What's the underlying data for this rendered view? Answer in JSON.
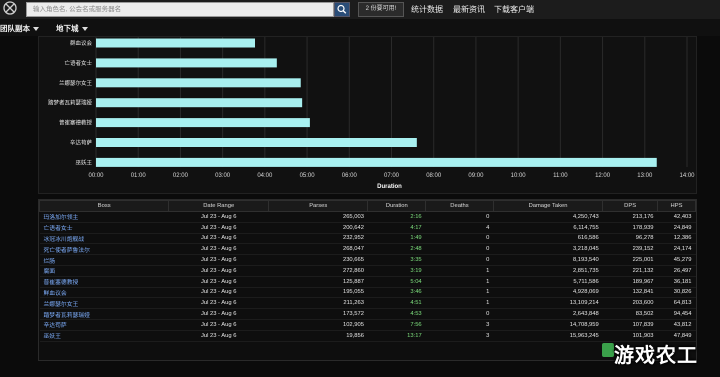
{
  "header": {
    "search_placeholder": "输入角色名, 公会名或服务器名",
    "compare_label": "2 份要可用!",
    "nav": [
      "统计数据",
      "最新资讯",
      "下载客户端"
    ]
  },
  "subnav": {
    "items": [
      "团队副本",
      "地下城"
    ]
  },
  "chart_data": {
    "type": "bar",
    "orientation": "horizontal",
    "categories": [
      "群血议会",
      "亡语者女士",
      "兰娜瑟尔女王",
      "踏梦者瓦莉瑟瑞娅",
      "普崔塞德教授",
      "辛达苟萨",
      "巫妖王"
    ],
    "values_seconds": [
      226,
      257,
      291,
      293,
      304,
      456,
      797
    ],
    "xlabel": "Duration",
    "xlim_seconds": [
      0,
      840
    ],
    "ticks": [
      "00:00",
      "01:00",
      "02:00",
      "03:00",
      "04:00",
      "05:00",
      "06:00",
      "07:00",
      "08:00",
      "09:00",
      "10:00",
      "11:00",
      "12:00",
      "13:00",
      "14:00"
    ],
    "bar_color": "#a8f0f0",
    "grid": true
  },
  "table": {
    "headers": [
      "Boss",
      "Date Range",
      "Parses",
      "Duration",
      "Deaths",
      "Damage Taken",
      "DPS",
      "HPS"
    ],
    "rows": [
      [
        "玛洛加尔领主",
        "Jul 23 - Aug 6",
        "265,003",
        "2:16",
        "0",
        "4,250,743",
        "213,176",
        "42,403"
      ],
      [
        "亡语者女士",
        "Jul 23 - Aug 6",
        "200,642",
        "4:17",
        "4",
        "6,114,755",
        "178,939",
        "24,849"
      ],
      [
        "冰冠冰川炮舰战",
        "Jul 23 - Aug 6",
        "232,952",
        "1:49",
        "0",
        "616,586",
        "96,278",
        "12,386"
      ],
      [
        "死亡使者萨鲁法尔",
        "Jul 23 - Aug 6",
        "268,047",
        "2:48",
        "0",
        "3,218,045",
        "239,152",
        "24,174"
      ],
      [
        "烂肠",
        "Jul 23 - Aug 6",
        "230,665",
        "3:35",
        "0",
        "8,193,540",
        "225,001",
        "45,279"
      ],
      [
        "腐面",
        "Jul 23 - Aug 6",
        "272,860",
        "3:19",
        "1",
        "2,851,735",
        "221,132",
        "26,497"
      ],
      [
        "普崔塞德教授",
        "Jul 23 - Aug 6",
        "125,887",
        "5:04",
        "1",
        "5,711,586",
        "189,967",
        "36,181"
      ],
      [
        "鲜血议会",
        "Jul 23 - Aug 6",
        "195,055",
        "3:46",
        "1",
        "4,928,069",
        "132,841",
        "30,826"
      ],
      [
        "兰娜瑟尔女王",
        "Jul 23 - Aug 6",
        "211,263",
        "4:51",
        "1",
        "13,109,214",
        "203,600",
        "64,813"
      ],
      [
        "踏梦者瓦莉瑟瑞娅",
        "Jul 23 - Aug 6",
        "173,572",
        "4:53",
        "0",
        "2,643,848",
        "83,502",
        "94,454"
      ],
      [
        "辛达苟萨",
        "Jul 23 - Aug 6",
        "102,905",
        "7:56",
        "3",
        "14,708,959",
        "107,839",
        "43,812"
      ],
      [
        "巫妖王",
        "Jul 23 - Aug 6",
        "19,856",
        "13:17",
        "3",
        "15,963,245",
        "101,903",
        "47,849"
      ]
    ]
  },
  "watermark": "游戏农工",
  "colors": {
    "accent": "#2a4d78",
    "bar": "#a8f0f0",
    "duration": "#7fe37f",
    "boss_link": "#7fb0ff"
  }
}
